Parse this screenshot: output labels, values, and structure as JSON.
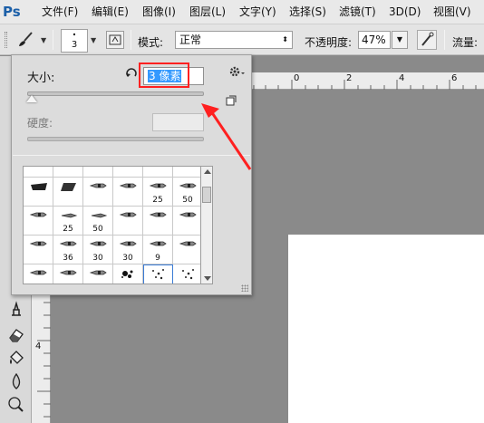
{
  "app": {
    "logo": "Ps"
  },
  "menu": [
    {
      "label": "文件(F)"
    },
    {
      "label": "编辑(E)"
    },
    {
      "label": "图像(I)"
    },
    {
      "label": "图层(L)"
    },
    {
      "label": "文字(Y)"
    },
    {
      "label": "选择(S)"
    },
    {
      "label": "滤镜(T)"
    },
    {
      "label": "3D(D)"
    },
    {
      "label": "视图(V)"
    }
  ],
  "options_bar": {
    "brush_size_preview": "3",
    "mode_label": "模式:",
    "mode_value": "正常",
    "opacity_label": "不透明度:",
    "opacity_value": "47%",
    "flow_label": "流量:"
  },
  "brush_picker": {
    "size_label": "大小:",
    "size_value": "3 像素",
    "size_slider_fraction": 0.0,
    "hardness_label": "硬度:",
    "hardness_value": "",
    "presets": [
      {
        "icon": "brush-soft-round",
        "size": ""
      },
      {
        "icon": "brush-hard-square",
        "size": ""
      },
      {
        "icon": "brush-pencil",
        "size": ""
      },
      {
        "icon": "brush-wedge",
        "size": ""
      },
      {
        "icon": "brush-soft-airbrush",
        "size": ""
      },
      {
        "icon": "brush-soft-airbrush",
        "size": ""
      },
      {
        "icon": "brush-flat-dark",
        "size": ""
      },
      {
        "icon": "brush-flat-angled",
        "size": ""
      },
      {
        "icon": "brush-marker",
        "size": ""
      },
      {
        "icon": "brush-marker",
        "size": ""
      },
      {
        "icon": "brush-marker",
        "size": "25"
      },
      {
        "icon": "brush-marker",
        "size": "50"
      },
      {
        "icon": "brush-marker",
        "size": ""
      },
      {
        "icon": "brush-pen",
        "size": "25"
      },
      {
        "icon": "brush-pen",
        "size": "50"
      },
      {
        "icon": "brush-marker",
        "size": ""
      },
      {
        "icon": "brush-marker",
        "size": ""
      },
      {
        "icon": "brush-marker",
        "size": ""
      },
      {
        "icon": "brush-marker",
        "size": ""
      },
      {
        "icon": "brush-marker",
        "size": "36"
      },
      {
        "icon": "brush-marker",
        "size": "30"
      },
      {
        "icon": "brush-marker",
        "size": "30"
      },
      {
        "icon": "brush-marker",
        "size": "9"
      },
      {
        "icon": "brush-marker",
        "size": ""
      },
      {
        "icon": "brush-marker",
        "size": ""
      },
      {
        "icon": "brush-marker",
        "size": ""
      },
      {
        "icon": "brush-marker",
        "size": ""
      },
      {
        "icon": "brush-splatter",
        "size": ""
      },
      {
        "icon": "brush-scatter",
        "size": ""
      },
      {
        "icon": "brush-scatter",
        "size": ""
      }
    ]
  },
  "rulers": {
    "h_labels": [
      "0",
      "2",
      "4",
      "6"
    ],
    "v_labels": [
      "4"
    ]
  },
  "annotation": {
    "highlight_color": "#ff2020"
  }
}
